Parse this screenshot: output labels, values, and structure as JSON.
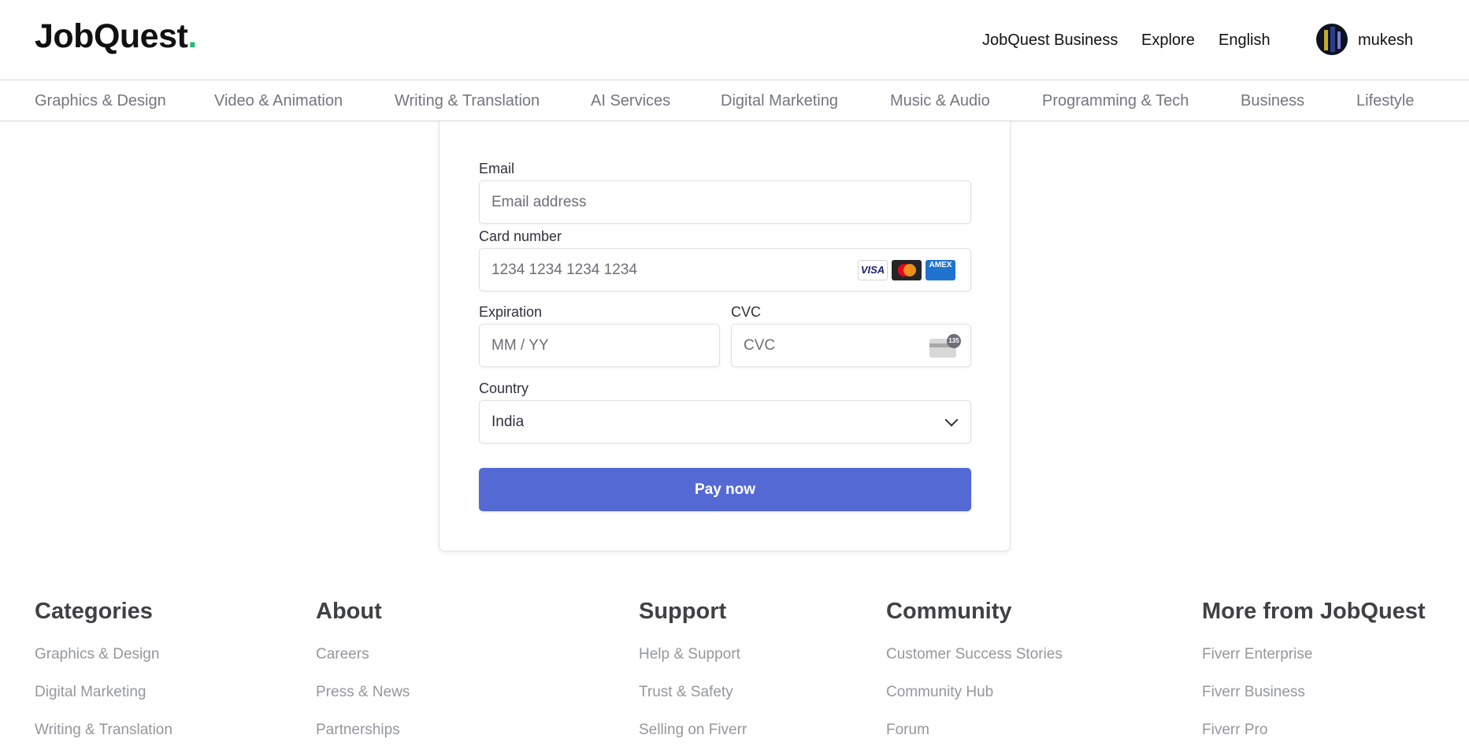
{
  "header": {
    "logo_text": "JobQuest",
    "logo_dot": ".",
    "nav": [
      "JobQuest Business",
      "Explore",
      "English"
    ],
    "username": "mukesh"
  },
  "categories": [
    "Graphics & Design",
    "Video & Animation",
    "Writing & Translation",
    "AI Services",
    "Digital Marketing",
    "Music & Audio",
    "Programming & Tech",
    "Business",
    "Lifestyle"
  ],
  "payment": {
    "email_label": "Email",
    "email_placeholder": "Email address",
    "card_label": "Card number",
    "card_placeholder": "1234 1234 1234 1234",
    "card_brands": [
      "VISA",
      "mastercard",
      "AMEX"
    ],
    "expiration_label": "Expiration",
    "expiration_placeholder": "MM / YY",
    "cvc_label": "CVC",
    "cvc_placeholder": "CVC",
    "cvc_icon_badge": "135",
    "country_label": "Country",
    "country_value": "India",
    "pay_button": "Pay now"
  },
  "footer": {
    "columns": [
      {
        "title": "Categories",
        "links": [
          "Graphics & Design",
          "Digital Marketing",
          "Writing & Translation"
        ]
      },
      {
        "title": "About",
        "links": [
          "Careers",
          "Press & News",
          "Partnerships"
        ]
      },
      {
        "title": "Support",
        "links": [
          "Help & Support",
          "Trust & Safety",
          "Selling on Fiverr"
        ]
      },
      {
        "title": "Community",
        "links": [
          "Customer Success Stories",
          "Community Hub",
          "Forum"
        ]
      },
      {
        "title": "More from JobQuest",
        "links": [
          "Fiverr Enterprise",
          "Fiverr Business",
          "Fiverr Pro"
        ]
      }
    ]
  },
  "colors": {
    "logo_dot": "#1dbf73",
    "pay_button": "#5469d4",
    "category_text": "#74767e",
    "footer_link": "#95979d"
  }
}
